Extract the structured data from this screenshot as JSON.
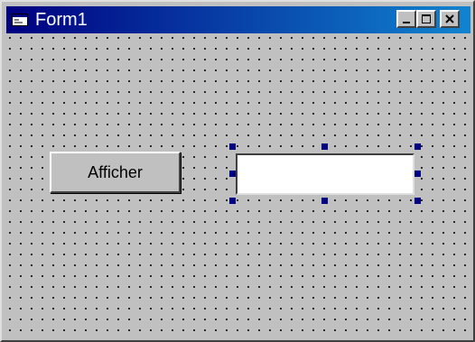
{
  "window": {
    "title": "Form1",
    "controls": {
      "minimize": "minimize-icon",
      "maximize": "maximize-icon",
      "close": "close-icon"
    }
  },
  "form": {
    "button_label": "Afficher",
    "textbox_value": ""
  },
  "colors": {
    "title_start": "#000080",
    "title_end": "#1084d0",
    "form_background": "#c0c0c0",
    "selection_handle": "#000080"
  }
}
